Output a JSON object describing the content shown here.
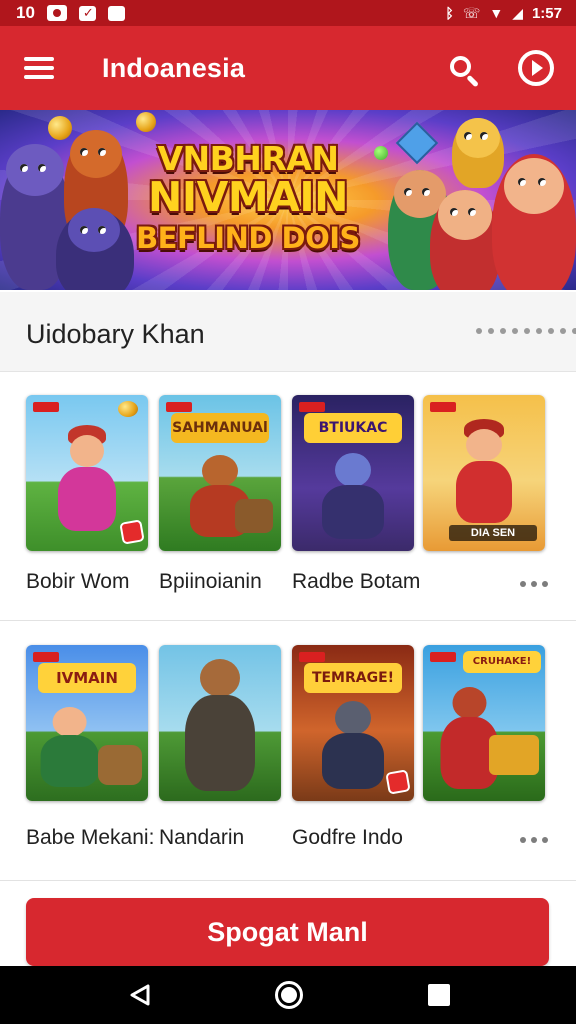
{
  "status_bar": {
    "time": "1:57",
    "left_number": "10",
    "icons": [
      "notification-icon",
      "checkbox-icon",
      "image-icon",
      "bluetooth-icon",
      "wifi-calling-icon",
      "wifi-icon",
      "signal-icon"
    ]
  },
  "app_bar": {
    "title": "Indoanesia",
    "icons": [
      "menu-icon",
      "search-icon",
      "play-circle-icon"
    ]
  },
  "hero": {
    "line1": "VNBHRAN",
    "line2": "NIVMAIN",
    "line3": "BEFLIND DOIS"
  },
  "section": {
    "title": "Uidobary Khan"
  },
  "games": [
    {
      "title": "Bobir Wom",
      "art_label": ""
    },
    {
      "title": "Bpiinoianin",
      "art_label": "SAHMANUAl"
    },
    {
      "title": "Radbe Botam",
      "art_label": "BTIUKAC"
    },
    {
      "title": "",
      "art_label": "DIA SEN"
    },
    {
      "title": "Babe Mekani:",
      "art_label": "IVMAIN"
    },
    {
      "title": "Nandarin",
      "art_label": ""
    },
    {
      "title": "Godfre Indo",
      "art_label": "TEMRAGE!"
    },
    {
      "title": "",
      "art_label": "CRUHAKE!"
    }
  ],
  "cta": {
    "label": "Spogat Manl"
  },
  "colors": {
    "primary": "#d7282f",
    "status_bar": "#b0161c",
    "section_bg": "#f5f5f5",
    "text": "#222222",
    "nav_bar": "#000000"
  }
}
